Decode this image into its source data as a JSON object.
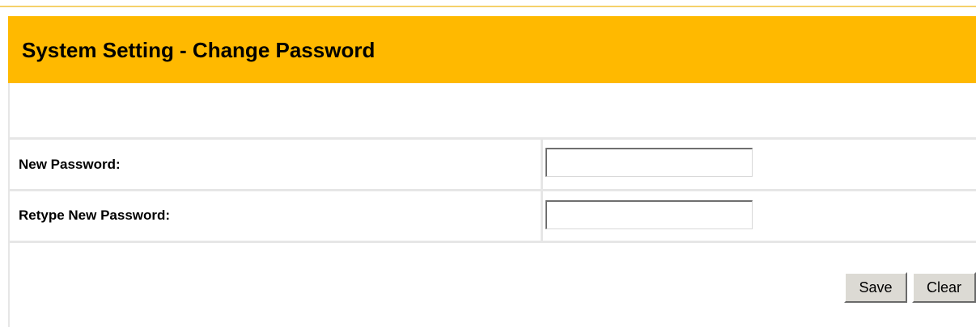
{
  "header": {
    "title": "System Setting - Change Password"
  },
  "form": {
    "new_password": {
      "label": "New Password:",
      "value": ""
    },
    "retype_new_password": {
      "label": "Retype New Password:",
      "value": ""
    }
  },
  "actions": {
    "save_label": "Save",
    "clear_label": "Clear"
  },
  "colors": {
    "header_background": "#ffb900",
    "table_border": "#e6e6e6",
    "button_face": "#dcdad4"
  }
}
